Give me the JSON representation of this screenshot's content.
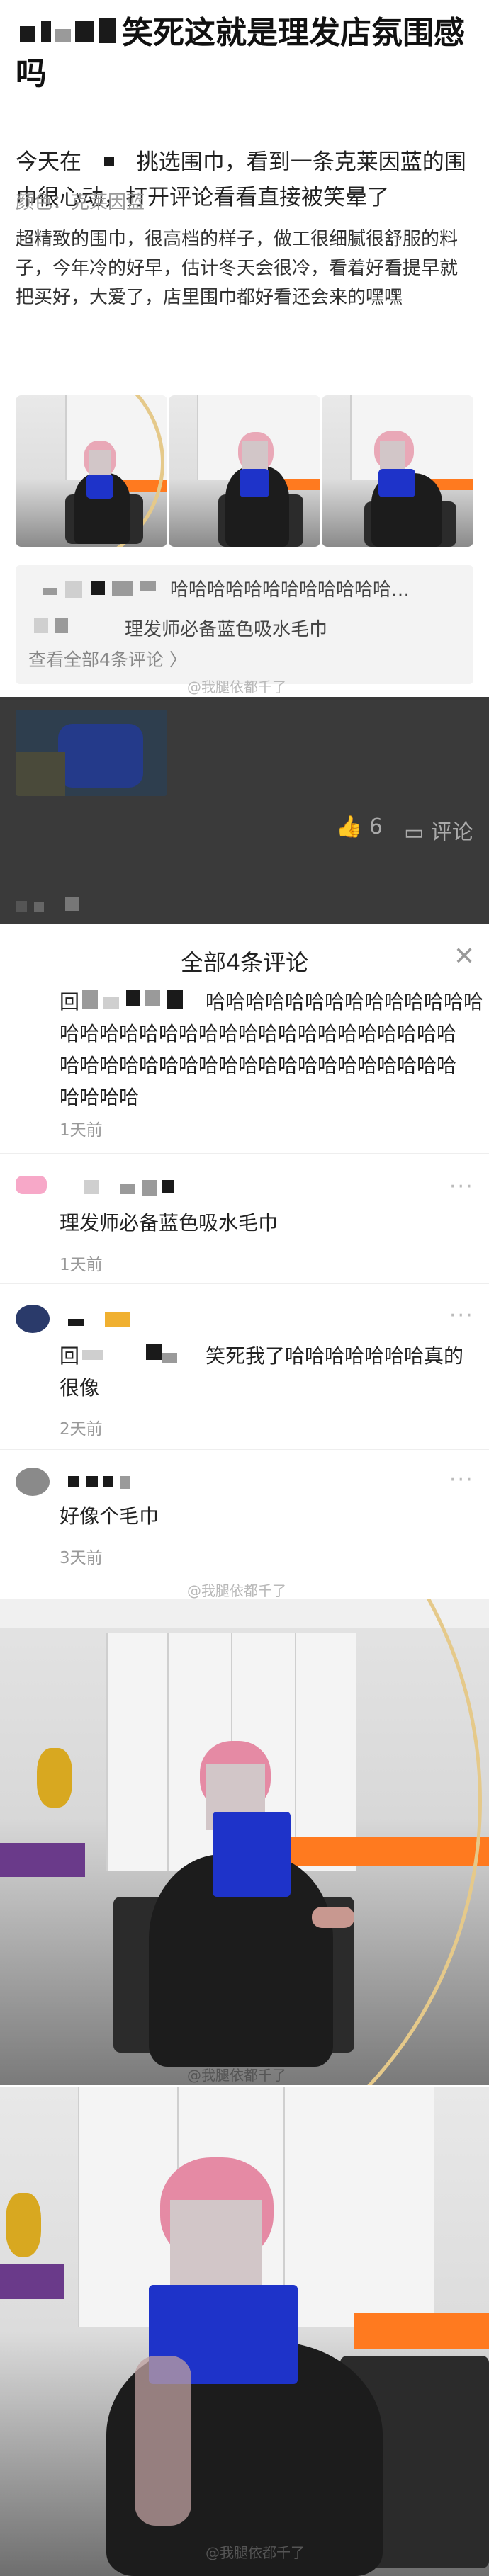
{
  "post": {
    "title": "笑死这就是理发店氛围感吗",
    "intro_prefix": "今天在",
    "intro_suffix": "挑选围巾，看到一条克莱因蓝的围巾很心动，打开评论看看直接被笑晕了",
    "color_label": "颜色：克莱因蓝",
    "review": "超精致的围巾，很高档的样子，做工很细腻很舒服的料子，今年冷的好早，估计冬天会很冷，看着好看提早就把买好，大爱了，店里围巾都好看还会来的嘿嘿"
  },
  "comment_preview": {
    "line1": "哈哈哈哈哈哈哈哈哈哈哈哈…",
    "line2": "理发师必备蓝色吸水毛巾",
    "view_all": "查看全部4条评论"
  },
  "watermark": "@我腿依都千了",
  "actions": {
    "likes": "6",
    "reply_label": "评论",
    "like_icon": "thumbs-up-icon",
    "reply_icon": "comment-icon"
  },
  "sheet": {
    "title": "全部4条评论",
    "close_icon": "close-icon",
    "comments": [
      {
        "prefix": "回",
        "text_line1": "哈哈哈哈哈哈哈哈哈哈哈哈哈哈",
        "text_rest": "哈哈哈哈哈哈哈哈哈哈哈哈哈哈哈哈哈哈哈哈哈哈哈哈哈哈哈哈哈哈哈哈哈哈哈哈哈哈哈哈哈哈哈哈",
        "time": "1天前"
      },
      {
        "text": "理发师必备蓝色吸水毛巾",
        "time": "1天前"
      },
      {
        "prefix": "回",
        "text_line1": "笑死我了哈哈哈哈哈哈哈真的",
        "text_rest": "很像",
        "time": "2天前"
      },
      {
        "text": "好像个毛巾",
        "time": "3天前"
      }
    ],
    "more_icon": "···"
  },
  "photo_watermarks": [
    "@我腿依都千了",
    "@我腿依都千了"
  ],
  "colors": {
    "scarf_blue": "#1e33c9",
    "hair_pink": "#e9a8b7",
    "orange_accent": "#ff7a1f",
    "mirror_gold": "#e5c98a"
  }
}
